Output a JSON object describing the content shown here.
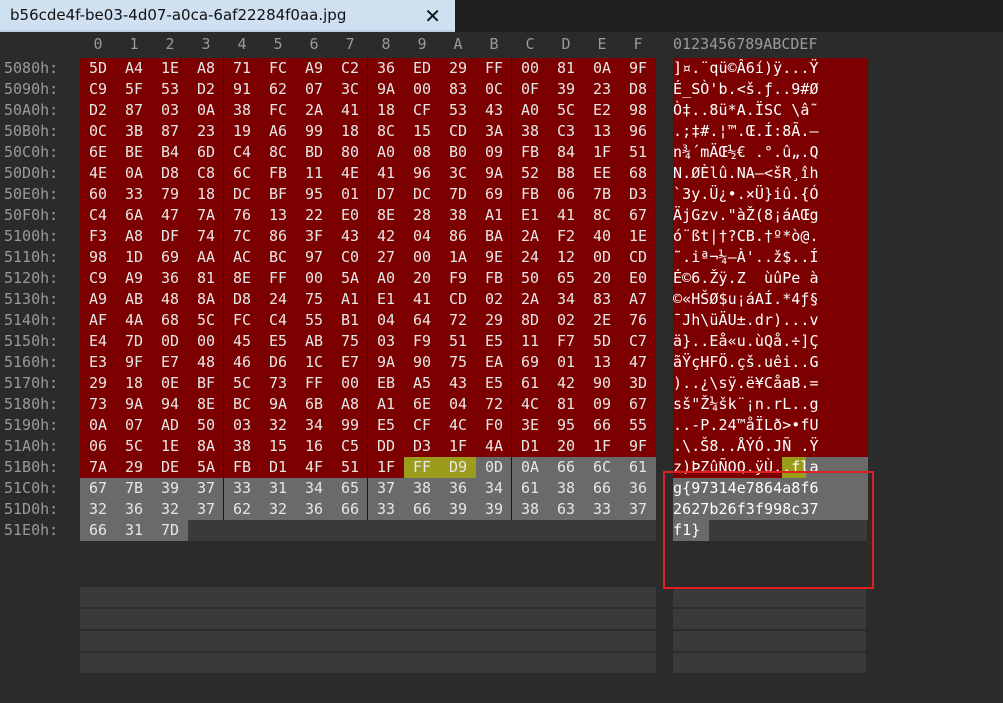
{
  "tab": {
    "title": "b56cde4f-be03-4d07-a0ca-6af22284f0aa.jpg",
    "close_icon": "close-icon"
  },
  "columns_hex": [
    "0",
    "1",
    "2",
    "3",
    "4",
    "5",
    "6",
    "7",
    "8",
    "9",
    "A",
    "B",
    "C",
    "D",
    "E",
    "F"
  ],
  "columns_ascii": "0123456789ABCDEF",
  "rows": [
    {
      "offset": "5080h:",
      "hex": [
        "5D",
        "A4",
        "1E",
        "A8",
        "71",
        "FC",
        "A9",
        "C2",
        "36",
        "ED",
        "29",
        "FF",
        "00",
        "81",
        "0A",
        "9F"
      ],
      "ascii": "]¤.¨qü©Â6í)ÿ...Ÿ"
    },
    {
      "offset": "5090h:",
      "hex": [
        "C9",
        "5F",
        "53",
        "D2",
        "91",
        "62",
        "07",
        "3C",
        "9A",
        "00",
        "83",
        "0C",
        "0F",
        "39",
        "23",
        "D8"
      ],
      "ascii": "É_SÒ'b.<š.ƒ..9#Ø"
    },
    {
      "offset": "50A0h:",
      "hex": [
        "D2",
        "87",
        "03",
        "0A",
        "38",
        "FC",
        "2A",
        "41",
        "18",
        "CF",
        "53",
        "43",
        "A0",
        "5C",
        "E2",
        "98"
      ],
      "ascii": "Ò‡..8ü*A.ÏSC \\â˜"
    },
    {
      "offset": "50B0h:",
      "hex": [
        "0C",
        "3B",
        "87",
        "23",
        "19",
        "A6",
        "99",
        "18",
        "8C",
        "15",
        "CD",
        "3A",
        "38",
        "C3",
        "13",
        "96"
      ],
      "ascii": ".;‡#.¦™.Œ.Í:8Ã.–"
    },
    {
      "offset": "50C0h:",
      "hex": [
        "6E",
        "BE",
        "B4",
        "6D",
        "C4",
        "8C",
        "BD",
        "80",
        "A0",
        "08",
        "B0",
        "09",
        "FB",
        "84",
        "1F",
        "51"
      ],
      "ascii": "n¾´mÄŒ½€ .°.û„.Q"
    },
    {
      "offset": "50D0h:",
      "hex": [
        "4E",
        "0A",
        "D8",
        "C8",
        "6C",
        "FB",
        "11",
        "4E",
        "41",
        "96",
        "3C",
        "9A",
        "52",
        "B8",
        "EE",
        "68"
      ],
      "ascii": "N.ØÈlû.NA–<šR¸îh"
    },
    {
      "offset": "50E0h:",
      "hex": [
        "60",
        "33",
        "79",
        "18",
        "DC",
        "BF",
        "95",
        "01",
        "D7",
        "DC",
        "7D",
        "69",
        "FB",
        "06",
        "7B",
        "D3"
      ],
      "ascii": "`3y.Ü¿•.×Ü}iû.{Ó"
    },
    {
      "offset": "50F0h:",
      "hex": [
        "C4",
        "6A",
        "47",
        "7A",
        "76",
        "13",
        "22",
        "E0",
        "8E",
        "28",
        "38",
        "A1",
        "E1",
        "41",
        "8C",
        "67"
      ],
      "ascii": "ÄjGzv.\"àŽ(8¡áAŒg"
    },
    {
      "offset": "5100h:",
      "hex": [
        "F3",
        "A8",
        "DF",
        "74",
        "7C",
        "86",
        "3F",
        "43",
        "42",
        "04",
        "86",
        "BA",
        "2A",
        "F2",
        "40",
        "1E"
      ],
      "ascii": "ó¨ßt|†?CB.†º*ò@."
    },
    {
      "offset": "5110h:",
      "hex": [
        "98",
        "1D",
        "69",
        "AA",
        "AC",
        "BC",
        "97",
        "C0",
        "27",
        "00",
        "1A",
        "9E",
        "24",
        "12",
        "0D",
        "CD"
      ],
      "ascii": "˜.iª¬¼—À'..ž$..Í"
    },
    {
      "offset": "5120h:",
      "hex": [
        "C9",
        "A9",
        "36",
        "81",
        "8E",
        "FF",
        "00",
        "5A",
        "A0",
        "20",
        "F9",
        "FB",
        "50",
        "65",
        "20",
        "E0"
      ],
      "ascii": "É©6.Žÿ.Z  ùûPe à"
    },
    {
      "offset": "5130h:",
      "hex": [
        "A9",
        "AB",
        "48",
        "8A",
        "D8",
        "24",
        "75",
        "A1",
        "E1",
        "41",
        "CD",
        "02",
        "2A",
        "34",
        "83",
        "A7"
      ],
      "ascii": "©«HŠØ$u¡áAÍ.*4ƒ§"
    },
    {
      "offset": "5140h:",
      "hex": [
        "AF",
        "4A",
        "68",
        "5C",
        "FC",
        "C4",
        "55",
        "B1",
        "04",
        "64",
        "72",
        "29",
        "8D",
        "02",
        "2E",
        "76"
      ],
      "ascii": "¯Jh\\üÄU±.dr)...v"
    },
    {
      "offset": "5150h:",
      "hex": [
        "E4",
        "7D",
        "0D",
        "00",
        "45",
        "E5",
        "AB",
        "75",
        "03",
        "F9",
        "51",
        "E5",
        "11",
        "F7",
        "5D",
        "C7"
      ],
      "ascii": "ä}..Eå«u.ùQå.÷]Ç"
    },
    {
      "offset": "5160h:",
      "hex": [
        "E3",
        "9F",
        "E7",
        "48",
        "46",
        "D6",
        "1C",
        "E7",
        "9A",
        "90",
        "75",
        "EA",
        "69",
        "01",
        "13",
        "47"
      ],
      "ascii": "ãŸçHFÖ.çš.uêi..G"
    },
    {
      "offset": "5170h:",
      "hex": [
        "29",
        "18",
        "0E",
        "BF",
        "5C",
        "73",
        "FF",
        "00",
        "EB",
        "A5",
        "43",
        "E5",
        "61",
        "42",
        "90",
        "3D"
      ],
      "ascii": ")..¿\\sÿ.ë¥CåaB.="
    },
    {
      "offset": "5180h:",
      "hex": [
        "73",
        "9A",
        "94",
        "8E",
        "BC",
        "9A",
        "6B",
        "A8",
        "A1",
        "6E",
        "04",
        "72",
        "4C",
        "81",
        "09",
        "67"
      ],
      "ascii": "sš\"Ž¼šk¨¡n.rL..g"
    },
    {
      "offset": "5190h:",
      "hex": [
        "0A",
        "07",
        "AD",
        "50",
        "03",
        "32",
        "34",
        "99",
        "E5",
        "CF",
        "4C",
        "F0",
        "3E",
        "95",
        "66",
        "55"
      ],
      "ascii": "..-P.24™åÏLð>•fU"
    },
    {
      "offset": "51A0h:",
      "hex": [
        "06",
        "5C",
        "1E",
        "8A",
        "38",
        "15",
        "16",
        "C5",
        "DD",
        "D3",
        "1F",
        "4A",
        "D1",
        "20",
        "1F",
        "9F"
      ],
      "ascii": ".\\.Š8..ÅÝÓ.JÑ .Ÿ"
    },
    {
      "offset": "51B0h:",
      "hex": [
        "7A",
        "29",
        "DE",
        "5A",
        "FB",
        "D1",
        "4F",
        "51",
        "1F",
        "FF",
        "D9",
        "0D",
        "0A",
        "66",
        "6C",
        "61"
      ],
      "ascii": "z)ÞZûÑOQ.ÿÙ..fla"
    },
    {
      "offset": "51C0h:",
      "hex": [
        "67",
        "7B",
        "39",
        "37",
        "33",
        "31",
        "34",
        "65",
        "37",
        "38",
        "36",
        "34",
        "61",
        "38",
        "66",
        "36"
      ],
      "ascii": "g{97314e7864a8f6"
    },
    {
      "offset": "51D0h:",
      "hex": [
        "32",
        "36",
        "32",
        "37",
        "62",
        "32",
        "36",
        "66",
        "33",
        "66",
        "39",
        "39",
        "38",
        "63",
        "33",
        "37"
      ],
      "ascii": "2627b26f3f998c37"
    },
    {
      "offset": "51E0h:",
      "hex": [
        "66",
        "31",
        "7D"
      ],
      "ascii": "f1}"
    }
  ],
  "highlight": {
    "row": 19,
    "cols": [
      9,
      10
    ]
  },
  "selection_start": {
    "row": 19,
    "col": 11
  },
  "colors": {
    "red": "#7d0000",
    "grey": "#6a6a6a",
    "highlight": "#9b9b1c",
    "box": "#e02020"
  }
}
